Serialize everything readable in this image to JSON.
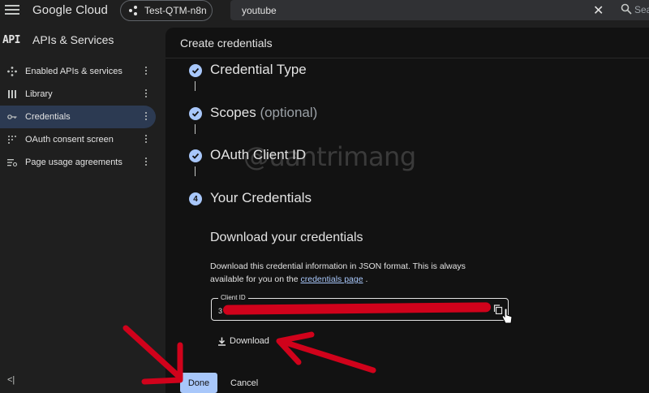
{
  "header": {
    "brand": "Google Cloud",
    "project": "Test-QTM-n8n",
    "search_value": "youtube",
    "search_label": "Sea"
  },
  "sidebar": {
    "logo": "API",
    "title": "APIs & Services",
    "items": [
      {
        "label": "Enabled APIs & services",
        "icon": "diamond-nodes-icon",
        "active": false
      },
      {
        "label": "Library",
        "icon": "library-icon",
        "active": false
      },
      {
        "label": "Credentials",
        "icon": "key-icon",
        "active": true
      },
      {
        "label": "OAuth consent screen",
        "icon": "dots-grid-icon",
        "active": false
      },
      {
        "label": "Page usage agreements",
        "icon": "settings-list-icon",
        "active": false
      }
    ],
    "collapse_label": "<|"
  },
  "panel": {
    "title": "Create credentials",
    "steps": [
      {
        "label": "Credential Type",
        "status": "done"
      },
      {
        "label": "Scopes",
        "optional": "(optional)",
        "status": "done"
      },
      {
        "label": "OAuth Client ID",
        "status": "done"
      },
      {
        "number": "4",
        "label": "Your Credentials",
        "status": "current"
      }
    ],
    "download_title": "Download your credentials",
    "download_desc": "Download this credential information in JSON format. This is always available for you on the",
    "download_link": "credentials page",
    "download_desc_end": ".",
    "client_id_label": "Client ID",
    "client_id_value": "3",
    "download_button": "Download",
    "done_button": "Done",
    "cancel_button": "Cancel"
  },
  "watermark": "@uantrimang",
  "colors": {
    "accent": "#a8c7fa",
    "active_nav": "#2c3a52",
    "annotation": "#d0021b"
  }
}
